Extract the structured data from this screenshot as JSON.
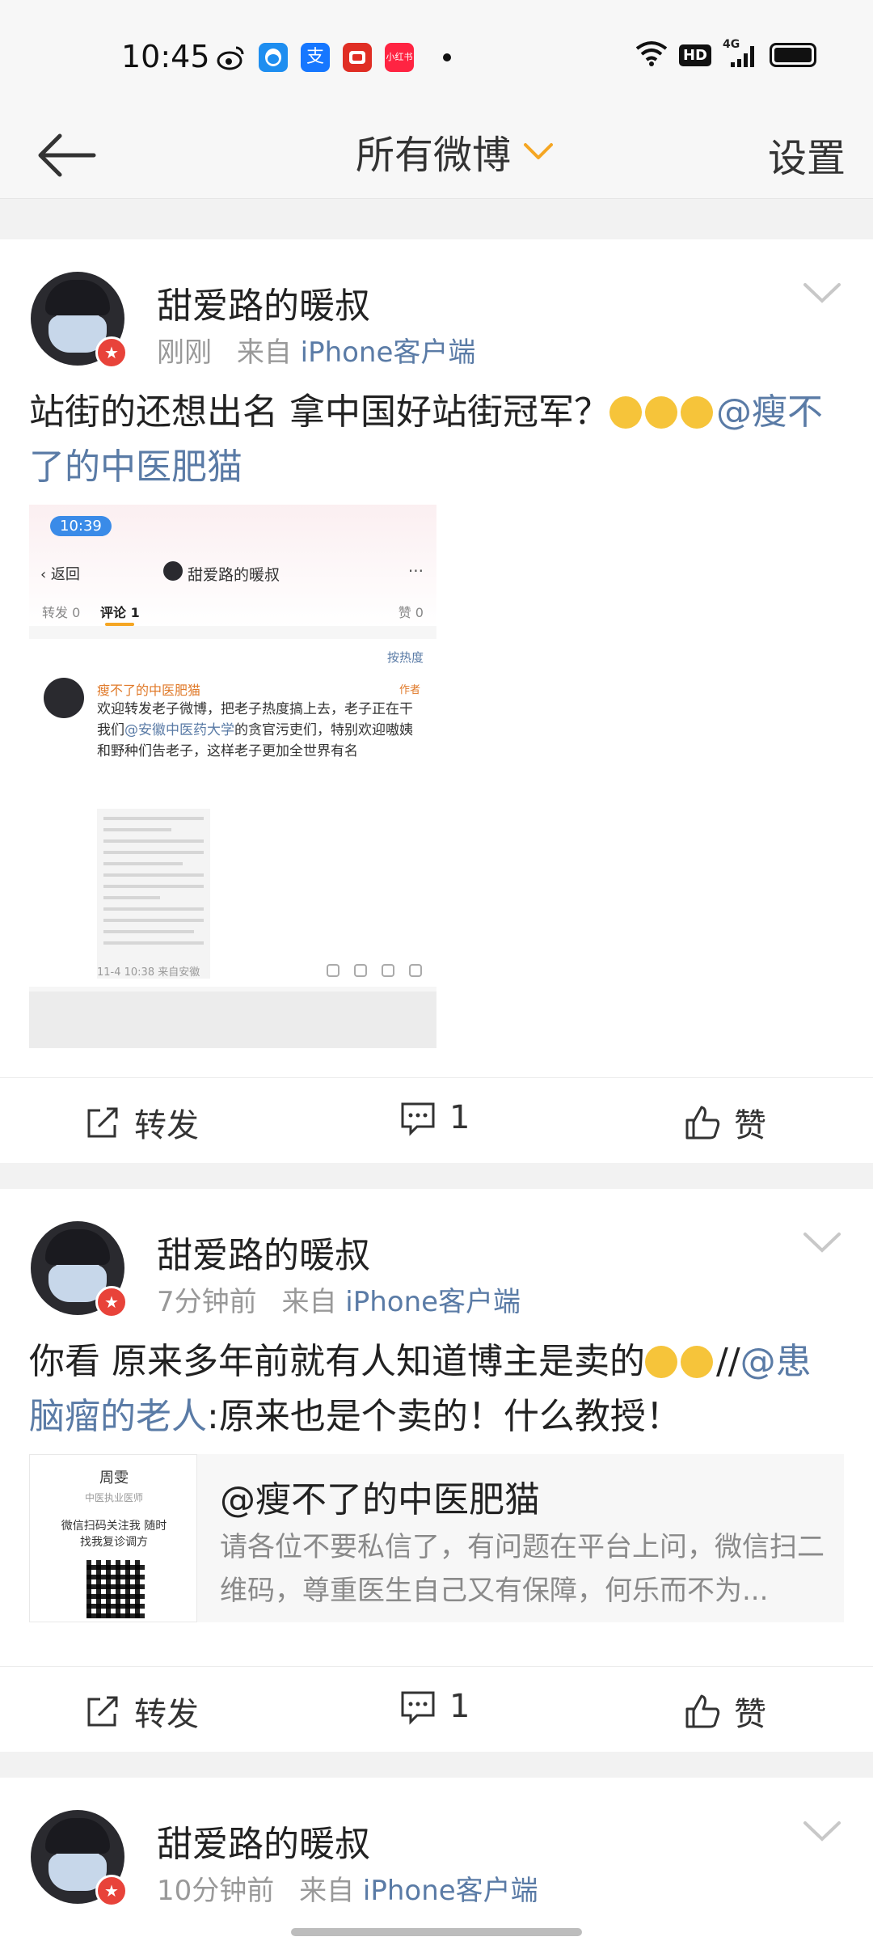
{
  "status_bar": {
    "time": "10:45",
    "app_icons": [
      "weibo-icon",
      "qq-icon",
      "alipay-icon",
      "pinduoduo-icon",
      "xiaohongshu-icon"
    ],
    "alipay_label": "支",
    "xhs_label": "小红书",
    "hd_label": "HD",
    "signal_label": "4G"
  },
  "header": {
    "title": "所有微博",
    "settings": "设置",
    "accent_color": "#f5a623"
  },
  "posts": [
    {
      "author": "甜爱路的暖叔",
      "time": "刚刚",
      "source_prefix": "来自",
      "source": "iPhone客户端",
      "text_before": "站街的还想出名 拿中国好站街冠军？",
      "mention": "@瘦不了的中医肥猫",
      "embedded_screenshot": {
        "time": "10:39",
        "back": "返回",
        "title": "甜爱路的暖叔",
        "tab_repost": "转发 0",
        "tab_comment": "评论 1",
        "tab_like": "赞 0",
        "sort": "按热度",
        "commenter": "瘦不了的中医肥猫",
        "author_tag": "作者",
        "comment_a": "欢迎转发老子微博，把老子热度搞上去，老子正在干我们",
        "comment_mention": "@安徽中医药大学",
        "comment_b": "的贪官污吏们，特别欢迎嗷姨和野种们告老子，这样老子更加全世界有名",
        "footer": "11-4 10:38 来自安徽"
      },
      "repost_label": "转发",
      "comment_count": "1",
      "like_label": "赞"
    },
    {
      "author": "甜爱路的暖叔",
      "time": "7分钟前",
      "source_prefix": "来自",
      "source": "iPhone客户端",
      "text_before": "你看 原来多年前就有人知道博主是卖的",
      "slashes": "//",
      "mention": "@患脑瘤的老人",
      "text_after": ":原来也是个卖的！什么教授！",
      "card": {
        "thumb_name": "周雯",
        "thumb_sub": "中医执业医师",
        "thumb_slogan": "微信扫码关注我 随时找我复诊调方",
        "title": "@瘦不了的中医肥猫",
        "desc": "请各位不要私信了，有问题在平台上问，微信扫二维码，尊重医生自己又有保障，何乐而不为..."
      },
      "repost_label": "转发",
      "comment_count": "1",
      "like_label": "赞"
    },
    {
      "author": "甜爱路的暖叔",
      "time": "10分钟前",
      "source_prefix": "来自",
      "source": "iPhone客户端"
    }
  ]
}
